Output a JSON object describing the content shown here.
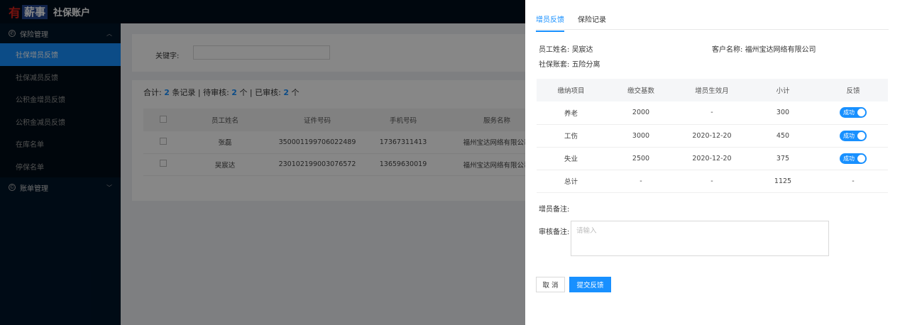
{
  "header": {
    "logo_you": "有",
    "logo_xin": "薪事",
    "title": "社保账户"
  },
  "sidebar": {
    "group1": {
      "label": "保险管理",
      "icon": "whatsapp-icon"
    },
    "items": [
      {
        "label": "社保增员反馈"
      },
      {
        "label": "社保减员反馈"
      },
      {
        "label": "公积金增员反馈"
      },
      {
        "label": "公积金减员反馈"
      },
      {
        "label": "在库名单"
      },
      {
        "label": "停保名单"
      }
    ],
    "group2": {
      "label": "账单管理",
      "icon": "copyright-icon"
    }
  },
  "search": {
    "label": "关键字:",
    "value": ""
  },
  "summary": {
    "prefix": "合计:",
    "total": "2",
    "mid1": "条记录 | 待审核:",
    "pending": "2",
    "mid2": "个 | 已审核:",
    "reviewed": "2",
    "suffix": "个"
  },
  "list": {
    "headers": [
      "员工姓名",
      "证件号码",
      "手机号码",
      "服务名称"
    ],
    "rows": [
      {
        "name": "张磊",
        "id": "350001199706022489",
        "phone": "17367311413",
        "service": "福州宝达网络有限公司"
      },
      {
        "name": "吴宸达",
        "id": "230102199003076572",
        "phone": "13659630019",
        "service": "福州宝达网络有限公司"
      }
    ]
  },
  "drawer": {
    "tabs": [
      "增员反馈",
      "保险记录"
    ],
    "employee_label": "员工姓名:",
    "employee_value": "吴宸达",
    "client_label": "客户名称:",
    "client_value": "福州宝达网络有限公司",
    "plan_label": "社保账套:",
    "plan_value": "五险分离",
    "table": {
      "headers": [
        "缴纳项目",
        "缴交基数",
        "增员生效月",
        "小计",
        "反馈"
      ],
      "rows": [
        {
          "item": "养老",
          "base": "2000",
          "month": "-",
          "subtotal": "300",
          "feedback": "成功"
        },
        {
          "item": "工伤",
          "base": "3000",
          "month": "2020-12-20",
          "subtotal": "450",
          "feedback": "成功"
        },
        {
          "item": "失业",
          "base": "2500",
          "month": "2020-12-20",
          "subtotal": "375",
          "feedback": "成功"
        }
      ],
      "total": {
        "item": "总计",
        "base": "-",
        "month": "-",
        "subtotal": "1125",
        "feedback": "-"
      }
    },
    "remark_label": "增员备注:",
    "review_label": "审核备注:",
    "review_placeholder": "请输入",
    "cancel_label": "取 消",
    "submit_label": "提交反馈"
  },
  "colors": {
    "primary": "#1890ff",
    "sidebar_bg": "#001529",
    "logo_red": "#d9221c",
    "logo_blue": "#22458e"
  }
}
